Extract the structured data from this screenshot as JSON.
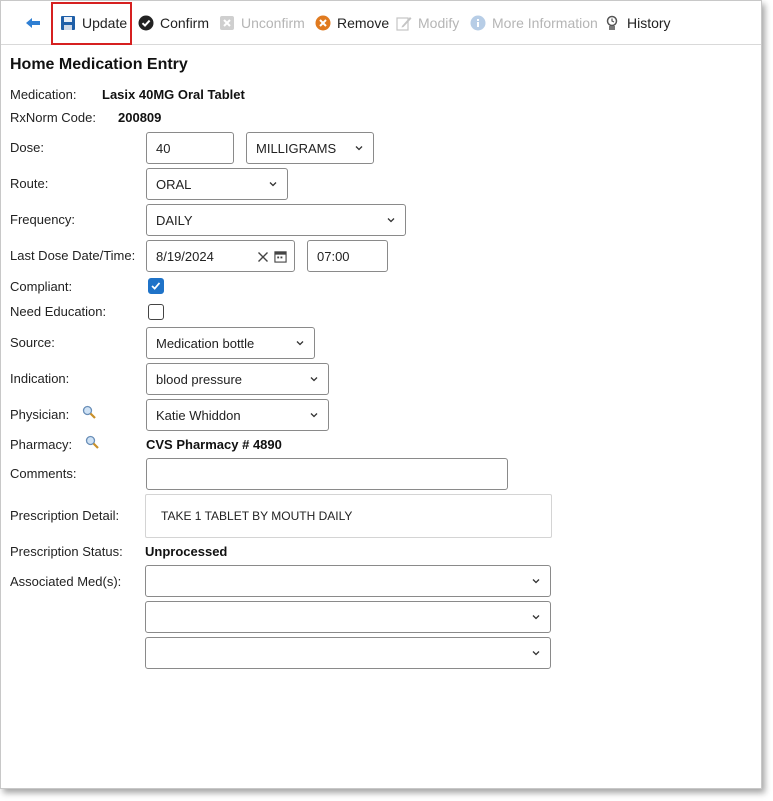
{
  "toolbar": {
    "update_label": "Update",
    "confirm_label": "Confirm",
    "unconfirm_label": "Unconfirm",
    "remove_label": "Remove",
    "modify_label": "Modify",
    "more_info_label": "More Information",
    "history_label": "History"
  },
  "form": {
    "title": "Home Medication Entry",
    "medication_label": "Medication:",
    "medication_value": "Lasix 40MG Oral Tablet",
    "rxnorm_label": "RxNorm Code:",
    "rxnorm_value": "200809",
    "dose_label": "Dose:",
    "dose_value": "40",
    "dose_unit": "MILLIGRAMS",
    "route_label": "Route:",
    "route_value": "ORAL",
    "frequency_label": "Frequency:",
    "frequency_value": "DAILY",
    "last_dose_label": "Last Dose Date/Time:",
    "last_dose_date": "8/19/2024",
    "last_dose_time": "07:00",
    "compliant_label": "Compliant:",
    "compliant_checked": true,
    "need_education_label": "Need Education:",
    "need_education_checked": false,
    "source_label": "Source:",
    "source_value": "Medication bottle",
    "indication_label": "Indication:",
    "indication_value": "blood pressure",
    "physician_label": "Physician:",
    "physician_value": "Katie Whiddon",
    "pharmacy_label": "Pharmacy:",
    "pharmacy_value": "CVS Pharmacy # 4890",
    "comments_label": "Comments:",
    "comments_value": "",
    "prescription_detail_label": "Prescription Detail:",
    "prescription_detail_value": "TAKE 1 TABLET BY MOUTH DAILY",
    "prescription_status_label": "Prescription Status:",
    "prescription_status_value": "Unprocessed",
    "associated_meds_label": "Associated Med(s):",
    "associated_meds": [
      "",
      "",
      ""
    ]
  },
  "colors": {
    "accent": "#1f73c8",
    "highlight": "#d62020",
    "disabled_text": "#b5b5b5"
  }
}
